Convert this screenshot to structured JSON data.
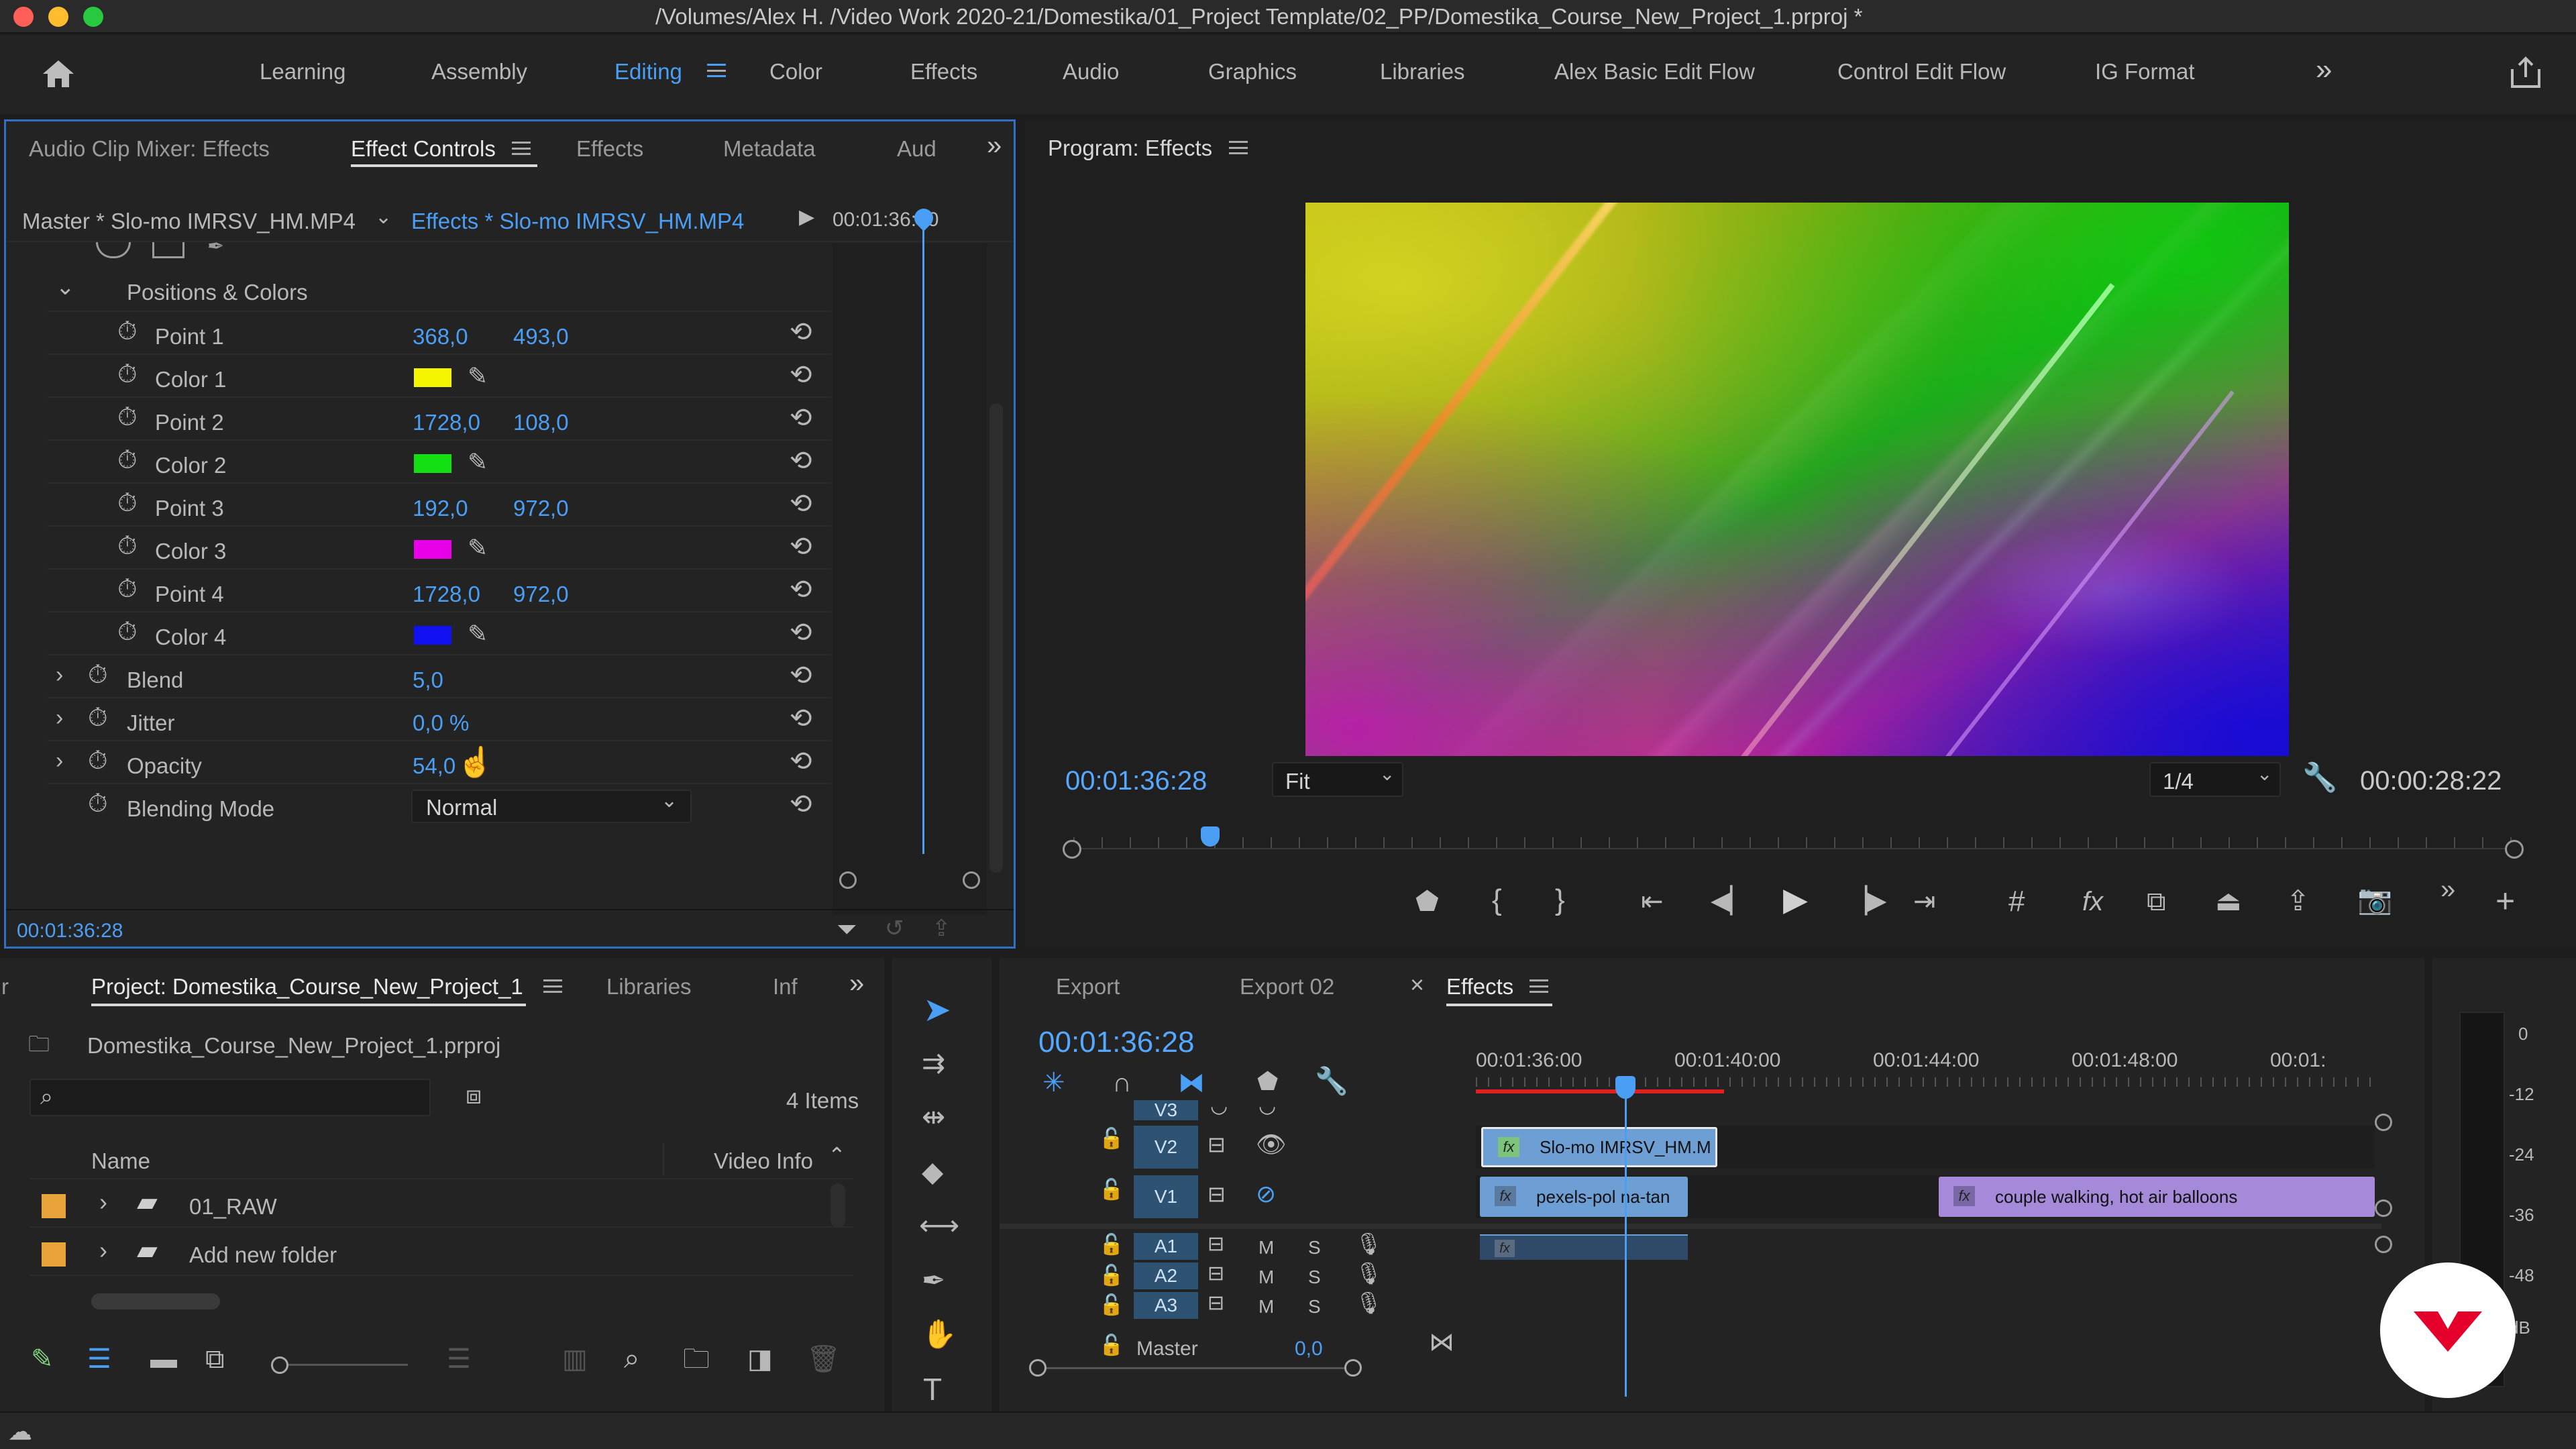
{
  "window": {
    "title": "/Volumes/Alex H. /Video Work 2020-21/Domestika/01_Project Template/02_PP/Domestika_Course_New_Project_1.prproj *"
  },
  "workspaces": {
    "items": [
      "Learning",
      "Assembly",
      "Editing",
      "Color",
      "Effects",
      "Audio",
      "Graphics",
      "Libraries",
      "Alex Basic Edit Flow",
      "Control Edit Flow",
      "IG Format"
    ],
    "active": "Editing"
  },
  "effect_controls": {
    "tabs": [
      "Audio Clip Mixer: Effects",
      "Effect Controls",
      "Effects",
      "Metadata",
      "Aud"
    ],
    "master_label": "Master * Slo-mo IMRSV_HM.MP4",
    "clip_label": "Effects * Slo-mo IMRSV_HM.MP4",
    "mini_timecode": "00:01:36:00",
    "section": "Positions & Colors",
    "params": [
      {
        "name": "Point 1",
        "x": "368,0",
        "y": "493,0"
      },
      {
        "name": "Color 1",
        "color": "#f5f500"
      },
      {
        "name": "Point 2",
        "x": "1728,0",
        "y": "108,0"
      },
      {
        "name": "Color 2",
        "color": "#12e012"
      },
      {
        "name": "Point 3",
        "x": "192,0",
        "y": "972,0"
      },
      {
        "name": "Color 3",
        "color": "#e800e8"
      },
      {
        "name": "Point 4",
        "x": "1728,0",
        "y": "972,0"
      },
      {
        "name": "Color 4",
        "color": "#1010f0"
      }
    ],
    "blend": {
      "name": "Blend",
      "value": "5,0"
    },
    "jitter": {
      "name": "Jitter",
      "value": "0,0 %"
    },
    "opacity": {
      "name": "Opacity",
      "value": "54,0"
    },
    "blending_mode": {
      "name": "Blending Mode",
      "value": "Normal"
    },
    "timecode": "00:01:36:28"
  },
  "program": {
    "title": "Program: Effects",
    "timecode": "00:01:36:28",
    "fit": "Fit",
    "quality": "1/4",
    "duration": "00:00:28:22",
    "playhead_fraction": 0.095
  },
  "project": {
    "tabs": [
      "Project: Domestika_Course_New_Project_1",
      "Libraries",
      "Inf"
    ],
    "file": "Domestika_Course_New_Project_1.prproj",
    "item_count": "4 Items",
    "columns": [
      "Name",
      "Video Info"
    ],
    "items": [
      {
        "name": "01_RAW",
        "color": "#e8a33a"
      },
      {
        "name": "Add new folder",
        "color": "#e8a33a"
      }
    ]
  },
  "timeline": {
    "tabs": [
      "Export",
      "Export 02",
      "Effects"
    ],
    "timecode": "00:01:36:28",
    "ruler": [
      "00:01:36:00",
      "00:01:40:00",
      "00:01:44:00",
      "00:01:48:00",
      "00:01:"
    ],
    "video_tracks": [
      "V3",
      "V2",
      "V1"
    ],
    "audio_tracks": [
      "A1",
      "A2",
      "A3"
    ],
    "audio_flags": {
      "mute": "M",
      "solo": "S"
    },
    "master": {
      "label": "Master",
      "value": "0,0"
    },
    "clips": {
      "v2": "Slo-mo IMRSV_HM.M",
      "v1a": "pexels-pol na-tan",
      "v1b": "couple walking, hot air balloons"
    },
    "fx_label": "fx"
  },
  "meter": {
    "scale": [
      "0",
      "-12",
      "-24",
      "-36",
      "-48",
      "dB"
    ]
  }
}
